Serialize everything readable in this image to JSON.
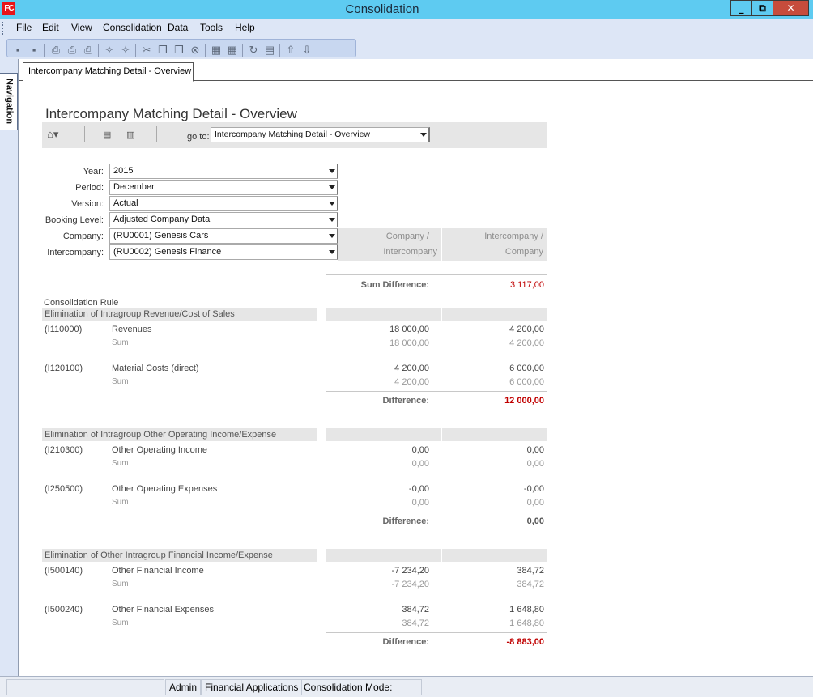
{
  "window": {
    "logo": "FC",
    "title": "Consolidation",
    "min": "_",
    "max": "⧉",
    "close": "✕"
  },
  "menu": [
    "File",
    "Edit",
    "View",
    "Consolidation",
    "Data",
    "Tools",
    "Help"
  ],
  "navigation": {
    "label": "Navigation"
  },
  "tab": {
    "label": "Intercompany Matching Detail - Overview"
  },
  "page": {
    "title": "Intercompany Matching Detail - Overview",
    "goto_label": "go to:",
    "goto_value": "Intercompany Matching Detail - Overview"
  },
  "params": [
    {
      "label": "Year:",
      "value": "2015"
    },
    {
      "label": "Period:",
      "value": "December"
    },
    {
      "label": "Version:",
      "value": "Actual"
    },
    {
      "label": "Booking Level:",
      "value": "Adjusted Company Data"
    },
    {
      "label": "Company:",
      "value": "(RU0001) Genesis Cars"
    },
    {
      "label": "Intercompany:",
      "value": "(RU0002) Genesis Finance"
    }
  ],
  "columns": {
    "c1_line1": "Company /",
    "c1_line2": "Intercompany",
    "c2_line1": "Intercompany /",
    "c2_line2": "Company"
  },
  "sum_difference": {
    "label": "Sum Difference:",
    "value": "3 117,00"
  },
  "consolidation_rule_label": "Consolidation Rule",
  "sections": [
    {
      "title": "Elimination of Intragroup Revenue/Cost of Sales",
      "accounts": [
        {
          "code": "(I110000)",
          "name": "Revenues",
          "v1": "18 000,00",
          "v2": "4 200,00",
          "sum_label": "Sum",
          "s1": "18 000,00",
          "s2": "4 200,00"
        },
        {
          "code": "(I120100)",
          "name": "Material Costs (direct)",
          "v1": "4 200,00",
          "v2": "6 000,00",
          "sum_label": "Sum",
          "s1": "4 200,00",
          "s2": "6 000,00"
        }
      ],
      "difference_label": "Difference:",
      "difference": "12 000,00",
      "difference_color": "#c00000"
    },
    {
      "title": "Elimination of Intragroup Other Operating Income/Expense",
      "accounts": [
        {
          "code": "(I210300)",
          "name": "Other Operating Income",
          "v1": "0,00",
          "v2": "0,00",
          "sum_label": "Sum",
          "s1": "0,00",
          "s2": "0,00"
        },
        {
          "code": "(I250500)",
          "name": "Other Operating Expenses",
          "v1": "-0,00",
          "v2": "-0,00",
          "sum_label": "Sum",
          "s1": "0,00",
          "s2": "0,00"
        }
      ],
      "difference_label": "Difference:",
      "difference": "0,00",
      "difference_color": "#555555"
    },
    {
      "title": "Elimination of Other Intragroup Financial Income/Expense",
      "accounts": [
        {
          "code": "(I500140)",
          "name": "Other Financial Income",
          "v1": "-7 234,20",
          "v2": "384,72",
          "sum_label": "Sum",
          "s1": "-7 234,20",
          "s2": "384,72"
        },
        {
          "code": "(I500240)",
          "name": "Other Financial Expenses",
          "v1": "384,72",
          "v2": "1 648,80",
          "sum_label": "Sum",
          "s1": "384,72",
          "s2": "1 648,80"
        }
      ],
      "difference_label": "Difference:",
      "difference": "-8 883,00",
      "difference_color": "#c00000"
    }
  ],
  "status": {
    "user": "Admin",
    "app": "Financial Applications",
    "mode": "Consolidation Mode: Normal"
  }
}
